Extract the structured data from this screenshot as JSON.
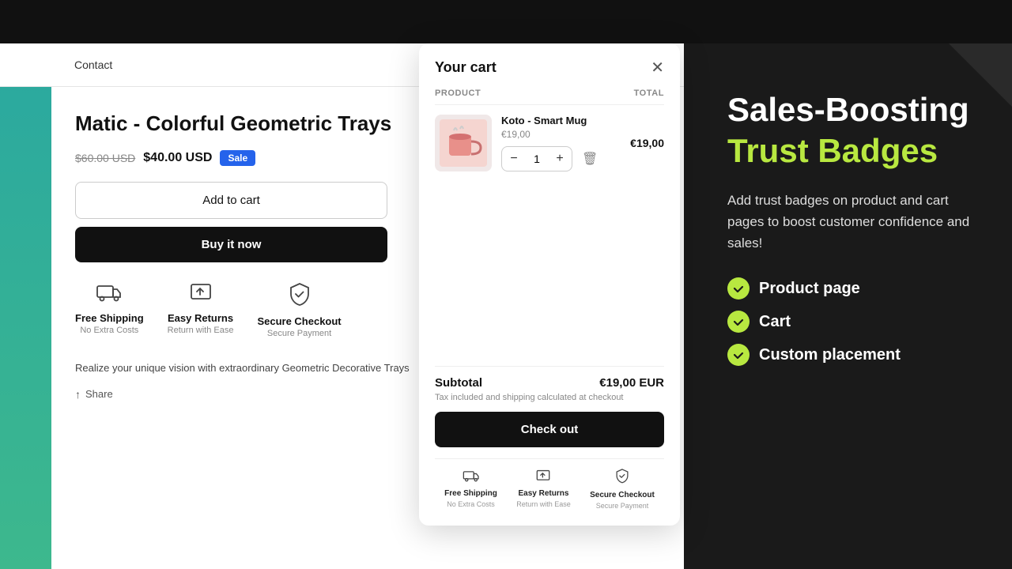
{
  "topbar": {
    "bg": "#111"
  },
  "nav": {
    "logo": "",
    "contact": "Contact",
    "search_icon": "🔍",
    "cart_icon": "🛍"
  },
  "product": {
    "title": "Matic - Colorful Geometric Trays",
    "price_original": "$60.00 USD",
    "price_sale": "$40.00 USD",
    "sale_badge": "Sale",
    "btn_add_to_cart": "Add to cart",
    "btn_buy_now": "Buy it now",
    "description": "Realize your unique vision with extraordinary Geometric Decorative Trays",
    "share_label": "Share"
  },
  "trust_badges": [
    {
      "id": "shipping",
      "icon": "🚚",
      "title": "Free Shipping",
      "subtitle": "No Extra Costs"
    },
    {
      "id": "returns",
      "icon": "📦",
      "title": "Easy Returns",
      "subtitle": "Return with Ease"
    },
    {
      "id": "secure",
      "icon": "🛡",
      "title": "Secure Checkout",
      "subtitle": "Secure Payment"
    }
  ],
  "cart": {
    "title": "Your cart",
    "col_product": "PRODUCT",
    "col_total": "TOTAL",
    "item": {
      "name": "Koto - Smart Mug",
      "price": "€19,00",
      "total": "€19,00",
      "qty": "1"
    },
    "subtotal_label": "Subtotal",
    "subtotal_value": "€19,00 EUR",
    "tax_note": "Tax included and shipping calculated at checkout",
    "btn_checkout": "Check out"
  },
  "cart_badges": [
    {
      "id": "cart-shipping",
      "title": "Free Shipping",
      "subtitle": "No Extra Costs"
    },
    {
      "id": "cart-returns",
      "title": "Easy Returns",
      "subtitle": "Return with Ease"
    },
    {
      "id": "cart-secure",
      "title": "Secure Checkout",
      "subtitle": "Secure Payment"
    }
  ],
  "promo": {
    "heading_white": "Sales-Boosting",
    "heading_green": "Trust Badges",
    "description": "Add trust badges on product and cart pages to boost customer confidence and sales!",
    "features": [
      "Product page",
      "Cart",
      "Custom placement"
    ]
  }
}
